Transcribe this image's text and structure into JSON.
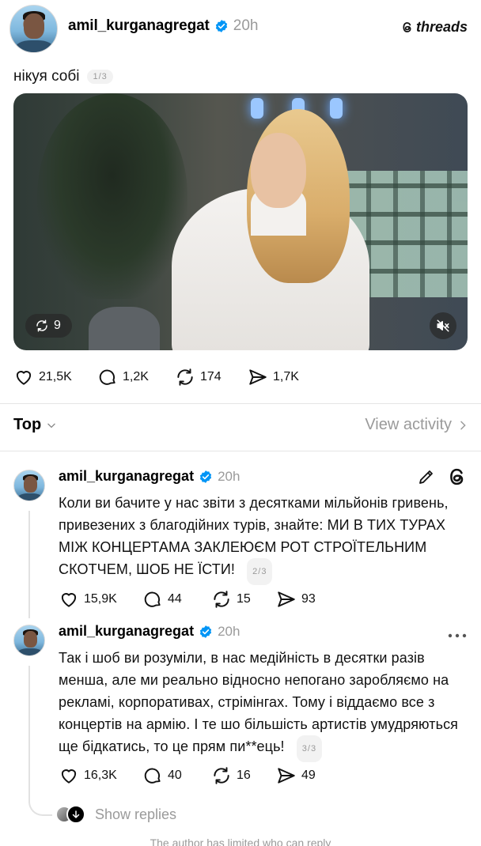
{
  "post": {
    "username": "amil_kurganagregat",
    "time": "20h",
    "brand": "threads",
    "text": "нікуя собі",
    "pager": "1/3",
    "media": {
      "repost_count": "9",
      "muted": true
    },
    "stats": {
      "likes": "21,5K",
      "comments": "1,2K",
      "reposts": "174",
      "shares": "1,7K"
    }
  },
  "sort": {
    "label": "Top",
    "view_activity": "View activity"
  },
  "replies": [
    {
      "username": "amil_kurganagregat",
      "time": "20h",
      "text": "Коли ви бачите у нас звіти з десятками мільйонів гривень, привезених з благодійних турів, знайте: МИ В ТИХ ТУРАХ МІЖ КОНЦЕРТАМА ЗАКЛЕЮЄМ РОТ СТРОЇТЕЛЬНИМ СКОТЧЕМ, ШОБ НЕ ЇСТИ!",
      "pager": "2/3",
      "stats": {
        "likes": "15,9K",
        "comments": "44",
        "reposts": "15",
        "shares": "93"
      }
    },
    {
      "username": "amil_kurganagregat",
      "time": "20h",
      "text": "Так і шоб ви розуміли, в нас медійність в десятки разів менша, але ми реально відносно непогано заробляємо на рекламі, корпоративах, стрімінгах. Тому і віддаємо все з концертів на армію. І те шо більшість артистів умудряються ще бідкатись, то це прям пи**ець!",
      "pager": "3/3",
      "stats": {
        "likes": "16,3K",
        "comments": "40",
        "reposts": "16",
        "shares": "49"
      }
    }
  ],
  "show_replies": "Show replies",
  "footer": "The author has limited who can reply"
}
